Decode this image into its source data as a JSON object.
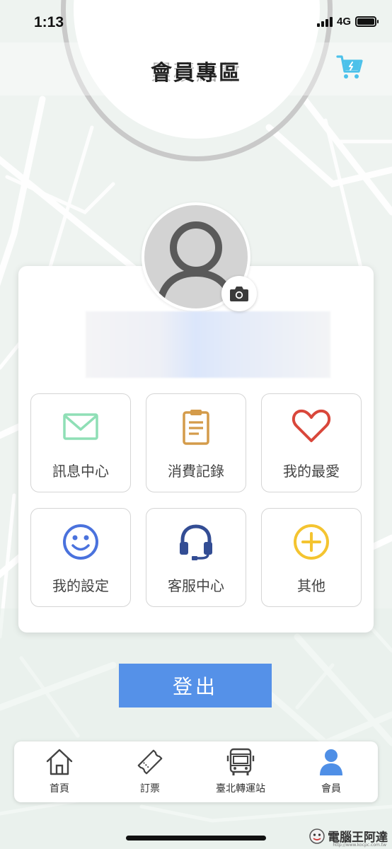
{
  "status_bar": {
    "time": "1:13",
    "network": "4G"
  },
  "header": {
    "title": "會員專區",
    "background_text": "累積點數"
  },
  "profile": {
    "username": ""
  },
  "grid": [
    {
      "label": "訊息中心",
      "icon": "envelope-icon",
      "color": "#8fdfb6"
    },
    {
      "label": "消費記錄",
      "icon": "clipboard-icon",
      "color": "#d49b4a"
    },
    {
      "label": "我的最愛",
      "icon": "heart-icon",
      "color": "#d9473b"
    },
    {
      "label": "我的設定",
      "icon": "smiley-icon",
      "color": "#4a72dd"
    },
    {
      "label": "客服中心",
      "icon": "headset-icon",
      "color": "#334d94"
    },
    {
      "label": "其他",
      "icon": "plus-circle-icon",
      "color": "#f4c430"
    }
  ],
  "logout_label": "登出",
  "nav": [
    {
      "label": "首頁",
      "icon": "home-icon",
      "active": false
    },
    {
      "label": "訂票",
      "icon": "ticket-icon",
      "active": false
    },
    {
      "label": "臺北轉運站",
      "icon": "bus-icon",
      "active": false
    },
    {
      "label": "會員",
      "icon": "user-icon",
      "active": true
    }
  ],
  "colors": {
    "accent": "#5591e8",
    "nav_active": "#4f8fe6",
    "cart": "#4cc1ea"
  },
  "watermark": {
    "text": "電腦王阿達",
    "url": "http://www.kocpc.com.tw"
  }
}
